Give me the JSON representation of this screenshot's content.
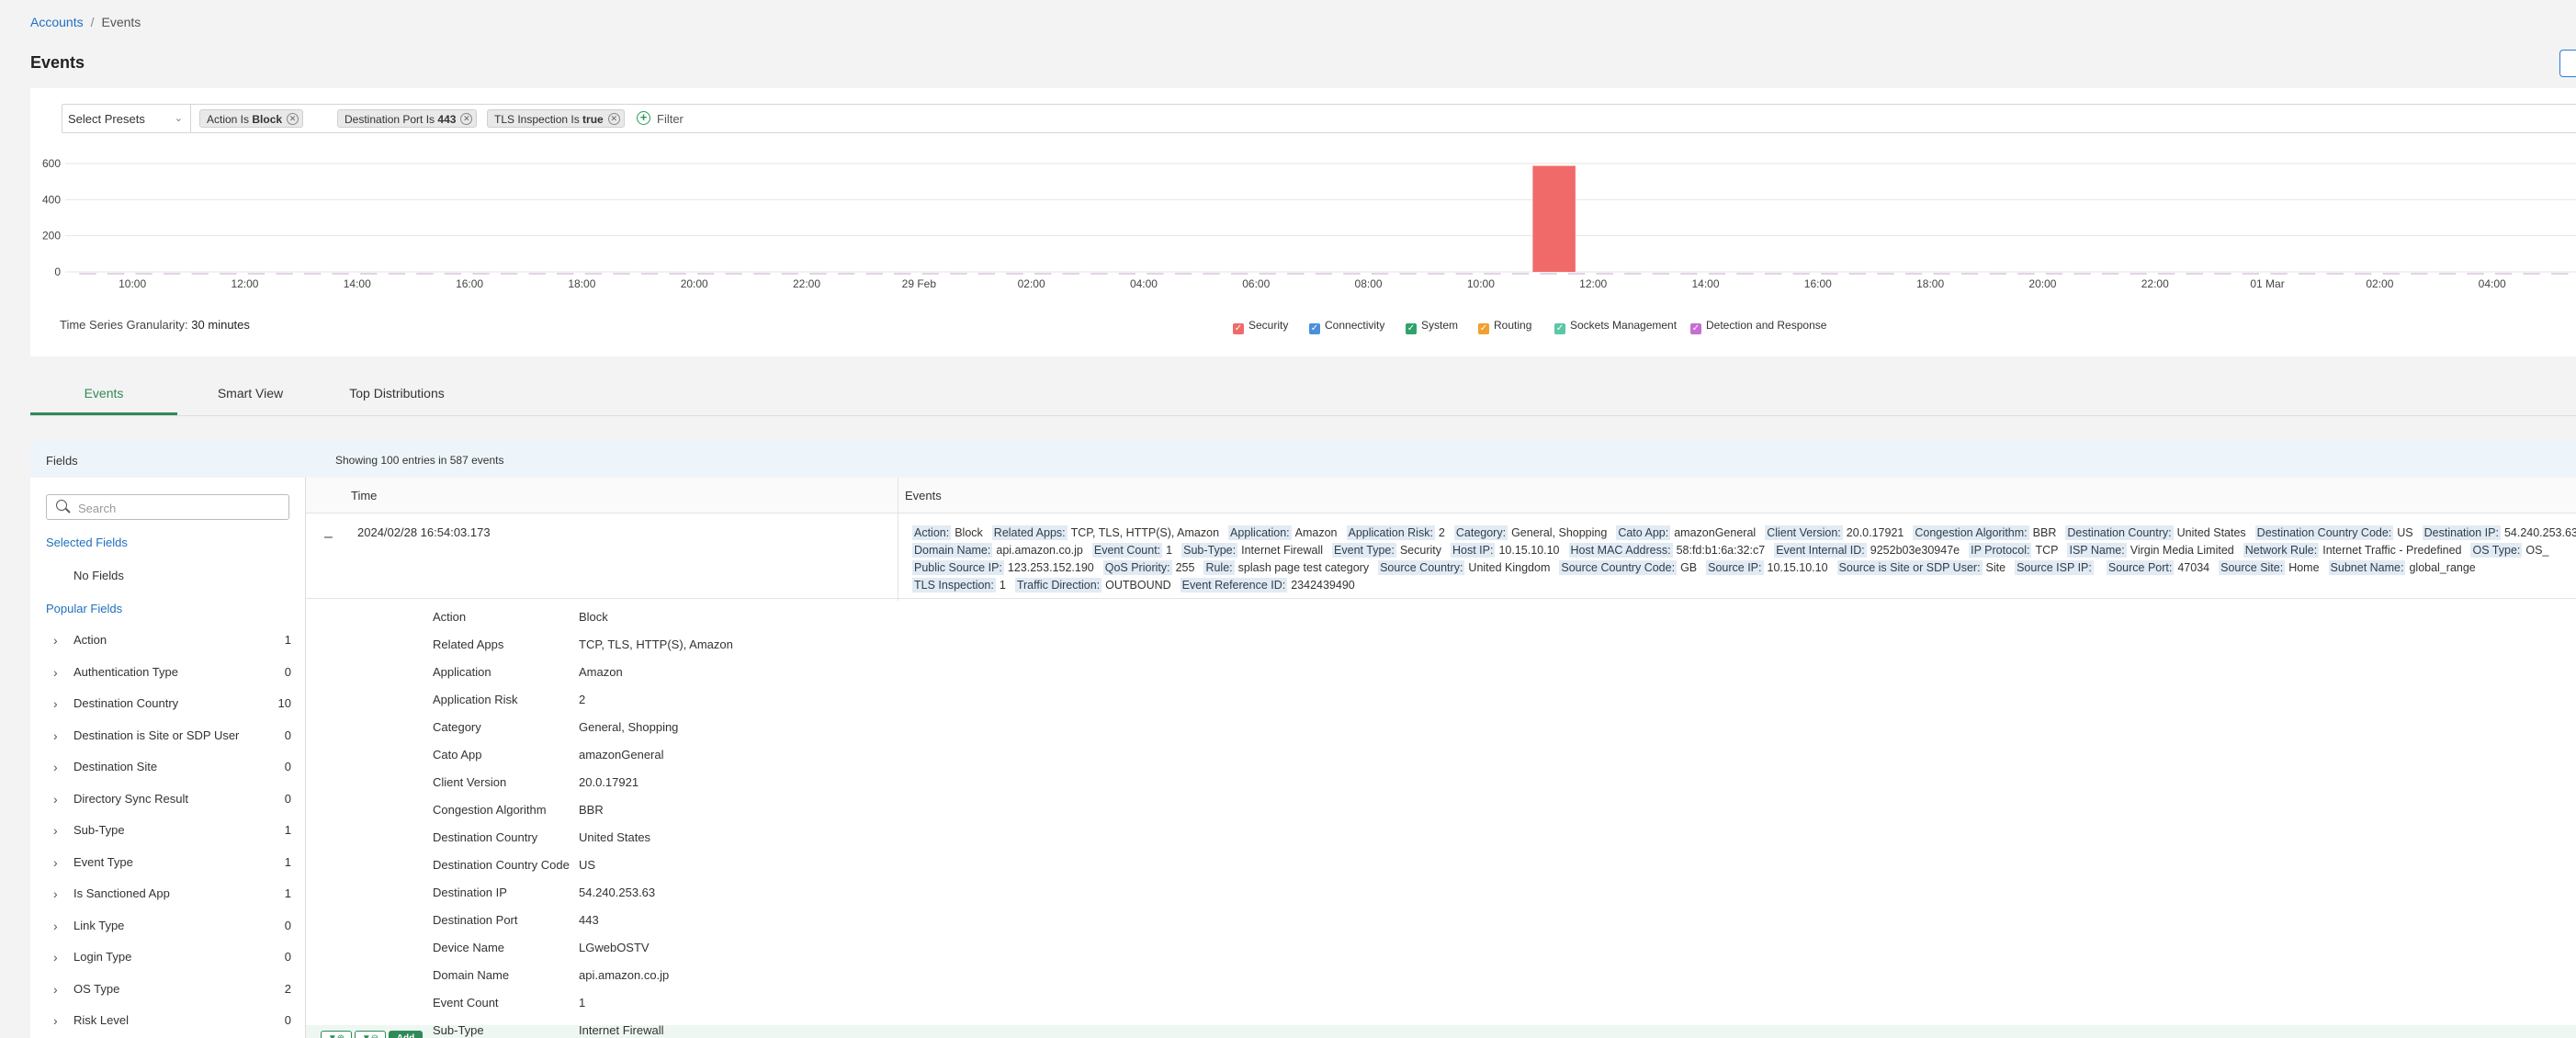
{
  "breadcrumb": {
    "root": "Accounts",
    "separator": "/",
    "current": "Events"
  },
  "page_title": "Events",
  "filters": {
    "preset_label": "Select Presets",
    "chips": [
      {
        "key": "Action Is ",
        "value": "Block"
      },
      {
        "key": "Destination Port Is ",
        "value": "443"
      },
      {
        "key": "TLS Inspection Is ",
        "value": "true"
      }
    ],
    "filter_placeholder": "Filter"
  },
  "chart_data": {
    "type": "bar",
    "ylim": [
      0,
      600
    ],
    "yticks": [
      "600",
      "400",
      "200",
      "0"
    ],
    "xticks": [
      "10:00",
      "12:00",
      "14:00",
      "16:00",
      "18:00",
      "20:00",
      "22:00",
      "29 Feb",
      "02:00",
      "04:00",
      "06:00",
      "08:00",
      "10:00",
      "12:00",
      "14:00",
      "16:00",
      "18:00",
      "20:00",
      "22:00",
      "01 Mar",
      "02:00",
      "04:00"
    ],
    "x_slot_count": 45,
    "series": [
      {
        "name": "Security",
        "color": "#f06a6a",
        "peak_slot": 13,
        "peak_value": 587
      }
    ]
  },
  "granularity": {
    "label": "Time Series Granularity:",
    "value": "30 minutes"
  },
  "legend": [
    {
      "label": "Security",
      "color": "#f06a6a"
    },
    {
      "label": "Connectivity",
      "color": "#4a90d9"
    },
    {
      "label": "System",
      "color": "#2fa36b"
    },
    {
      "label": "Routing",
      "color": "#f0a030"
    },
    {
      "label": "Sockets Management",
      "color": "#5ac8a8"
    },
    {
      "label": "Detection and Response",
      "color": "#c56fd0"
    }
  ],
  "tabs": [
    "Events",
    "Smart View",
    "Top Distributions"
  ],
  "fields_panel": {
    "title": "Fields",
    "search_placeholder": "Search",
    "selected_title": "Selected Fields",
    "no_fields": "No Fields",
    "popular_title": "Popular Fields",
    "popular": [
      {
        "name": "Action",
        "count": "1"
      },
      {
        "name": "Authentication Type",
        "count": "0"
      },
      {
        "name": "Destination Country",
        "count": "10"
      },
      {
        "name": "Destination is Site or SDP User",
        "count": "0"
      },
      {
        "name": "Destination Site",
        "count": "0"
      },
      {
        "name": "Directory Sync Result",
        "count": "0"
      },
      {
        "name": "Sub-Type",
        "count": "1"
      },
      {
        "name": "Event Type",
        "count": "1"
      },
      {
        "name": "Is Sanctioned App",
        "count": "1"
      },
      {
        "name": "Link Type",
        "count": "0"
      },
      {
        "name": "Login Type",
        "count": "0"
      },
      {
        "name": "OS Type",
        "count": "2"
      },
      {
        "name": "Risk Level",
        "count": "0"
      }
    ]
  },
  "events_panel": {
    "summary": "Showing 100 entries in 587 events",
    "col_time": "Time",
    "col_events": "Events",
    "row_time": "2024/02/28 16:54:03.173",
    "line1": [
      [
        "Action:",
        "Block"
      ],
      [
        "Related Apps:",
        "TCP, TLS, HTTP(S), Amazon"
      ],
      [
        "Application:",
        "Amazon"
      ],
      [
        "Application Risk:",
        "2"
      ],
      [
        "Category:",
        "General, Shopping"
      ],
      [
        "Cato App:",
        "amazonGeneral"
      ],
      [
        "Client Version:",
        "20.0.17921"
      ],
      [
        "Congestion Algorithm:",
        "BBR"
      ],
      [
        "Destination Country:",
        "United States"
      ],
      [
        "Destination Country Code:",
        "US"
      ],
      [
        "Destination IP:",
        "54.240.253.63"
      ]
    ],
    "line2": [
      [
        "Domain Name:",
        "api.amazon.co.jp"
      ],
      [
        "Event Count:",
        "1"
      ],
      [
        "Sub-Type:",
        "Internet Firewall"
      ],
      [
        "Event Type:",
        "Security"
      ],
      [
        "Host IP:",
        "10.15.10.10"
      ],
      [
        "Host MAC Address:",
        "58:fd:b1:6a:32:c7"
      ],
      [
        "Event Internal ID:",
        "9252b03e30947e"
      ],
      [
        "IP Protocol:",
        "TCP"
      ],
      [
        "ISP Name:",
        "Virgin Media Limited"
      ],
      [
        "Network Rule:",
        "Internet Traffic - Predefined"
      ],
      [
        "OS Type:",
        "OS_"
      ]
    ],
    "line3": [
      [
        "Public Source IP:",
        "123.253.152.190"
      ],
      [
        "QoS Priority:",
        "255"
      ],
      [
        "Rule:",
        "splash page test category"
      ],
      [
        "Source Country:",
        "United Kingdom"
      ],
      [
        "Source Country Code:",
        "GB"
      ],
      [
        "Source IP:",
        "10.15.10.10"
      ],
      [
        "Source is Site or SDP User:",
        "Site"
      ],
      [
        "Source ISP IP:",
        ""
      ],
      [
        "Source Port:",
        "47034"
      ],
      [
        "Source Site:",
        "Home"
      ],
      [
        "Subnet Name:",
        "global_range"
      ]
    ],
    "line4": [
      [
        "TLS Inspection:",
        "1"
      ],
      [
        "Traffic Direction:",
        "OUTBOUND"
      ],
      [
        "Event Reference ID:",
        "2342439490"
      ]
    ],
    "details": [
      [
        "Action",
        "Block"
      ],
      [
        "Related Apps",
        "TCP, TLS, HTTP(S), Amazon"
      ],
      [
        "Application",
        "Amazon"
      ],
      [
        "Application Risk",
        "2"
      ],
      [
        "Category",
        "General, Shopping"
      ],
      [
        "Cato App",
        "amazonGeneral"
      ],
      [
        "Client Version",
        "20.0.17921"
      ],
      [
        "Congestion Algorithm",
        "BBR"
      ],
      [
        "Destination Country",
        "United States"
      ],
      [
        "Destination Country Code",
        "US"
      ],
      [
        "Destination IP",
        "54.240.253.63"
      ],
      [
        "Destination Port",
        "443"
      ],
      [
        "Device Name",
        "LGwebOSTV"
      ],
      [
        "Domain Name",
        "api.amazon.co.jp"
      ],
      [
        "Event Count",
        "1"
      ],
      [
        "Sub-Type",
        "Internet Firewall"
      ]
    ],
    "add_label": "Add"
  }
}
